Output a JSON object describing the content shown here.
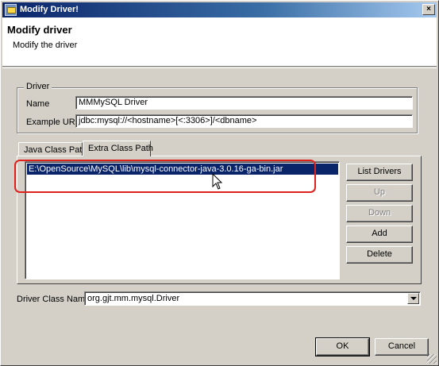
{
  "window": {
    "title": "Modify Driver!",
    "close_glyph": "×"
  },
  "banner": {
    "heading": "Modify driver",
    "subtitle": "Modify the driver"
  },
  "driver_group": {
    "legend": "Driver",
    "name_label": "Name",
    "name_value": "MMMySQL Driver",
    "url_label": "Example URL",
    "url_value": "jdbc:mysql://<hostname>[<:3306>]/<dbname>"
  },
  "tabs": [
    {
      "label": "Java Class Path",
      "active": false
    },
    {
      "label": "Extra Class Path",
      "active": true
    }
  ],
  "class_path_list": {
    "items": [
      {
        "text": "E:\\OpenSource\\MySQL\\lib\\mysql-connector-java-3.0.16-ga-bin.jar",
        "selected": true
      }
    ]
  },
  "side_buttons": {
    "list_drivers": "List Drivers",
    "up": "Up",
    "down": "Down",
    "add": "Add",
    "delete": "Delete"
  },
  "driver_class": {
    "label": "Driver Class Name",
    "value": "org.gjt.mm.mysql.Driver"
  },
  "footer": {
    "ok": "OK",
    "cancel": "Cancel"
  },
  "colors": {
    "selection": "#0a246a",
    "highlight_annotation": "#e0201c",
    "dialog_face": "#d4d0c8"
  }
}
